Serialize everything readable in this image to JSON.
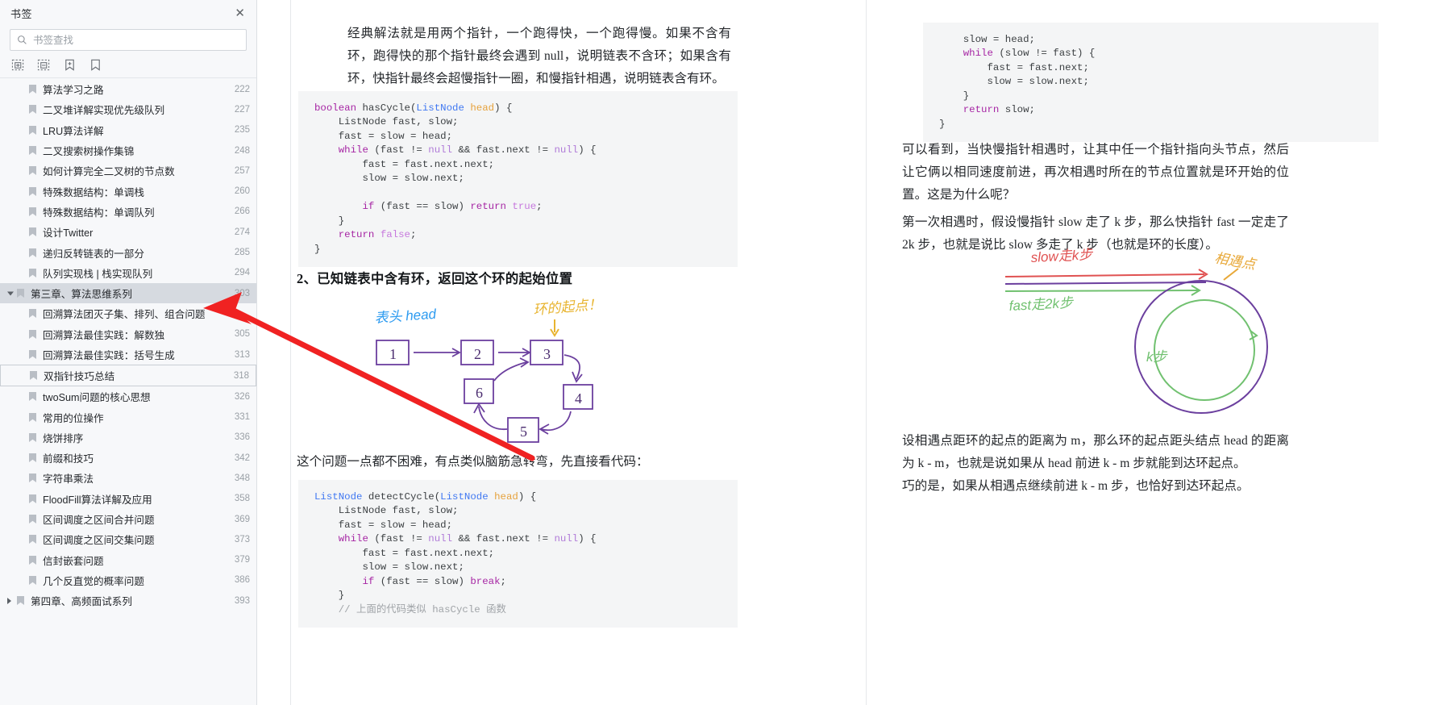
{
  "sidebar": {
    "title": "书签",
    "close_icon": "close-icon",
    "search": {
      "placeholder": "书签查找",
      "value": "",
      "icon": "search-icon"
    },
    "toolbar": [
      {
        "name": "expand-all-icon",
        "label": "展开全部"
      },
      {
        "name": "collapse-all-icon",
        "label": "收起全部"
      },
      {
        "name": "add-bookmark-icon",
        "label": "添加书签"
      },
      {
        "name": "remove-bookmark-icon",
        "label": "删除书签"
      }
    ],
    "items": [
      {
        "label": "算法学习之路",
        "page": "222",
        "level": 1,
        "state": "none"
      },
      {
        "label": "二叉堆详解实现优先级队列",
        "page": "227",
        "level": 1,
        "state": "none"
      },
      {
        "label": "LRU算法详解",
        "page": "235",
        "level": 1,
        "state": "none",
        "mono_prefix": "LRU"
      },
      {
        "label": "二叉搜索树操作集锦",
        "page": "248",
        "level": 1,
        "state": "none"
      },
      {
        "label": "如何计算完全二叉树的节点数",
        "page": "257",
        "level": 1,
        "state": "none"
      },
      {
        "label": "特殊数据结构：单调栈",
        "page": "260",
        "level": 1,
        "state": "none"
      },
      {
        "label": "特殊数据结构：单调队列",
        "page": "266",
        "level": 1,
        "state": "none"
      },
      {
        "label": "设计Twitter",
        "page": "274",
        "level": 1,
        "state": "none"
      },
      {
        "label": "递归反转链表的一部分",
        "page": "285",
        "level": 1,
        "state": "none"
      },
      {
        "label": "队列实现栈 | 栈实现队列",
        "page": "294",
        "level": 1,
        "state": "none"
      },
      {
        "label": "第三章、算法思维系列",
        "page": "303",
        "level": 0,
        "state": "selected",
        "caret": "open"
      },
      {
        "label": "回溯算法团灭子集、排列、组合问题",
        "page": "",
        "level": 1,
        "state": "none"
      },
      {
        "label": "回溯算法最佳实践：解数独",
        "page": "305",
        "level": 1,
        "state": "none"
      },
      {
        "label": "回溯算法最佳实践：括号生成",
        "page": "313",
        "level": 1,
        "state": "none"
      },
      {
        "label": "双指针技巧总结",
        "page": "318",
        "level": 1,
        "state": "outlined"
      },
      {
        "label": "twoSum问题的核心思想",
        "page": "326",
        "level": 1,
        "state": "none"
      },
      {
        "label": "常用的位操作",
        "page": "331",
        "level": 1,
        "state": "none"
      },
      {
        "label": "烧饼排序",
        "page": "336",
        "level": 1,
        "state": "none"
      },
      {
        "label": "前缀和技巧",
        "page": "342",
        "level": 1,
        "state": "none"
      },
      {
        "label": "字符串乘法",
        "page": "348",
        "level": 1,
        "state": "none"
      },
      {
        "label": "FloodFill算法详解及应用",
        "page": "358",
        "level": 1,
        "state": "none"
      },
      {
        "label": "区间调度之区间合并问题",
        "page": "369",
        "level": 1,
        "state": "none"
      },
      {
        "label": "区间调度之区间交集问题",
        "page": "373",
        "level": 1,
        "state": "none"
      },
      {
        "label": "信封嵌套问题",
        "page": "379",
        "level": 1,
        "state": "none"
      },
      {
        "label": "几个反直觉的概率问题",
        "page": "386",
        "level": 1,
        "state": "none"
      },
      {
        "label": "第四章、高频面试系列",
        "page": "393",
        "level": 0,
        "state": "none",
        "caret": "closed"
      }
    ]
  },
  "document": {
    "left_column": {
      "paragraph_1": "经典解法就是用两个指针，一个跑得快，一个跑得慢。如果不含有环，跑得快的那个指针最终会遇到 null，说明链表不含环；如果含有环，快指针最终会超慢指针一圈，和慢指针相遇，说明链表含有环。",
      "code_1": {
        "lines": [
          "boolean hasCycle(ListNode head) {",
          "    ListNode fast, slow;",
          "    fast = slow = head;",
          "    while (fast != null && fast.next != null) {",
          "        fast = fast.next.next;",
          "        slow = slow.next;",
          "",
          "        if (fast == slow) return true;",
          "    }",
          "    return false;",
          "}"
        ]
      },
      "heading_2": "2、已知链表中含有环，返回这个环的起始位置",
      "figure_1": {
        "label_head": "表头 head",
        "label_cycle_start": "环的起点！",
        "nodes": [
          "1",
          "2",
          "3",
          "4",
          "5",
          "6"
        ]
      },
      "paragraph_2": "这个问题一点都不困难，有点类似脑筋急转弯，先直接看代码：",
      "code_2": {
        "lines": [
          "ListNode detectCycle(ListNode head) {",
          "    ListNode fast, slow;",
          "    fast = slow = head;",
          "    while (fast != null && fast.next != null) {",
          "        fast = fast.next.next;",
          "        slow = slow.next;",
          "        if (fast == slow) break;",
          "    }",
          "    // 上面的代码类似 hasCycle 函数"
        ]
      }
    },
    "right_column": {
      "code_3": {
        "lines": [
          "    slow = head;",
          "    while (slow != fast) {",
          "        fast = fast.next;",
          "        slow = slow.next;",
          "    }",
          "    return slow;",
          "}"
        ]
      },
      "paragraph_3": "可以看到，当快慢指针相遇时，让其中任一个指针指向头节点，然后让它俩以相同速度前进，再次相遇时所在的节点位置就是环开始的位置。这是为什么呢？",
      "paragraph_4": "第一次相遇时，假设慢指针 slow 走了 k 步，那么快指针 fast 一定走了 2k 步，也就是说比 slow 多走了 k 步（也就是环的长度）。",
      "figure_2": {
        "label_slow": "slow走k步",
        "label_fast": "fast走2k步",
        "label_meet": "相遇点",
        "label_k": "k步"
      },
      "paragraph_5": "设相遇点距环的起点的距离为 m，那么环的起点距头结点 head 的距离为 k - m，也就是说如果从 head 前进 k - m 步就能到达环起点。",
      "paragraph_6": "巧的是，如果从相遇点继续前进 k - m 步，也恰好到达环起点。"
    }
  },
  "annotation": {
    "arrow_color": "#f02222",
    "arrow_target": "第三章、算法思维系列"
  }
}
